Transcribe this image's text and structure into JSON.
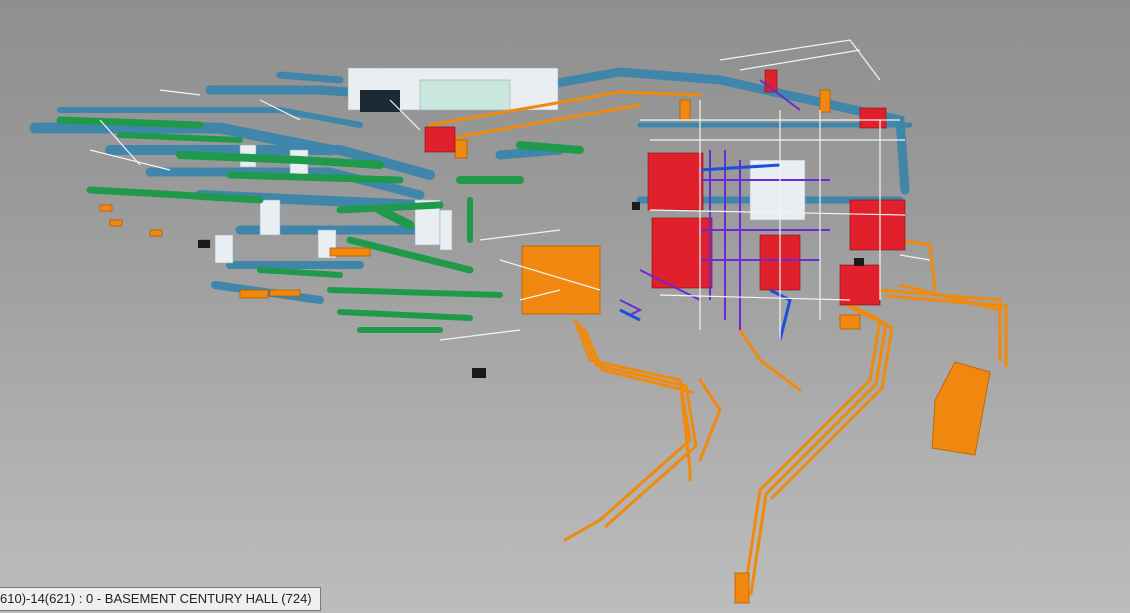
{
  "viewport": {
    "status_text": "610)-14(621) : 0 - BASEMENT CENTURY HALL (724)"
  },
  "colors": {
    "duct_blue": "#4a8fb3",
    "pipe_green": "#1f9a4a",
    "conduit_orange": "#ef8a0c",
    "equipment_red": "#e0202a",
    "equipment_white": "#eef2f4",
    "pipe_purple": "#6a2bd6"
  }
}
